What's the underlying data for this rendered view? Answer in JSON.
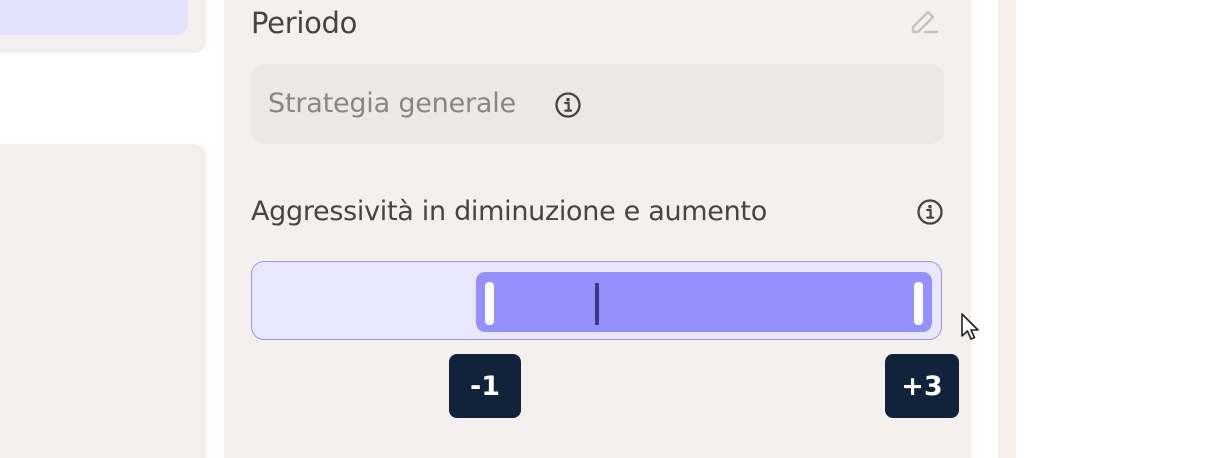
{
  "section": {
    "title": "Periodo",
    "edit_icon": "pencil-icon"
  },
  "strategy": {
    "label": "Strategia generale",
    "info_icon": "info-icon"
  },
  "aggressiveness": {
    "title": "Aggressività in diminuzione e aumento",
    "info_icon": "info-icon",
    "range_min_label": "-1",
    "range_max_label": "+3",
    "range_min": -1,
    "range_max": 3
  },
  "colors": {
    "accent": "#9491fd",
    "track": "#e9e7fb",
    "badge": "#10233a",
    "panel": "#f3f0ed"
  }
}
